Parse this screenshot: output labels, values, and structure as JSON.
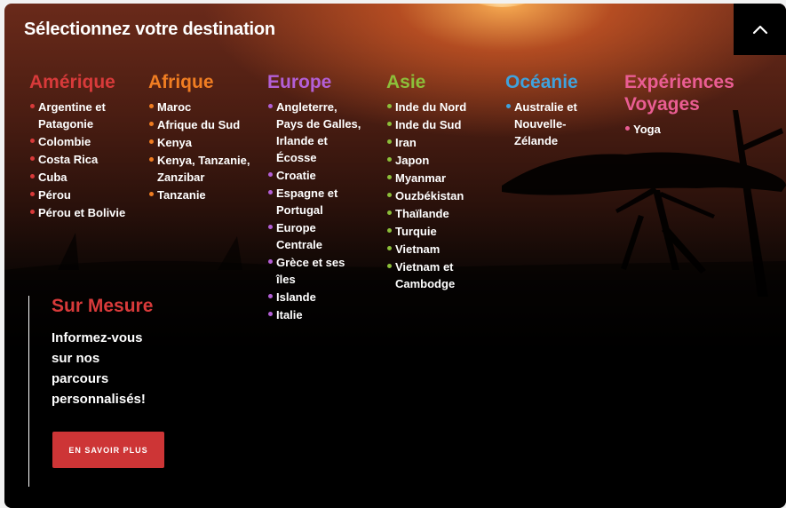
{
  "title": "Sélectionnez votre destination",
  "collapse_icon": "chevron-up-icon",
  "regions": [
    {
      "name": "Amérique",
      "color": "#d83a3a",
      "items": [
        "Argentine et Patagonie",
        "Colombie",
        "Costa Rica",
        "Cuba",
        "Pérou",
        "Pérou et Bolivie"
      ]
    },
    {
      "name": "Afrique",
      "color": "#f07d22",
      "items": [
        "Maroc",
        "Afrique du Sud",
        "Kenya",
        "Kenya, Tanzanie, Zanzibar",
        "Tanzanie"
      ]
    },
    {
      "name": "Europe",
      "color": "#b35fd6",
      "items": [
        "Angleterre, Pays de Galles, Irlande et Écosse",
        "Croatie",
        "Espagne et Portugal",
        "Europe Centrale",
        "Grèce et ses îles",
        "Islande",
        "Italie"
      ]
    },
    {
      "name": "Asie",
      "color": "#8cbf3a",
      "items": [
        "Inde du Nord",
        "Inde du Sud",
        "Iran",
        "Japon",
        "Myanmar",
        "Ouzbékistan",
        "Thaïlande",
        "Turquie",
        "Vietnam",
        "Vietnam et Cambodge"
      ]
    },
    {
      "name": "Océanie",
      "color": "#3fa2dd",
      "items": [
        "Australie et Nouvelle-Zélande"
      ]
    },
    {
      "name": "Expériences Voyages",
      "color": "#ea5d93",
      "items": [
        "Yoga"
      ]
    }
  ],
  "sur_mesure": {
    "title": "Sur Mesure",
    "text": "Informez-vous sur nos parcours personnalisés!",
    "button": "EN SAVOIR PLUS"
  }
}
